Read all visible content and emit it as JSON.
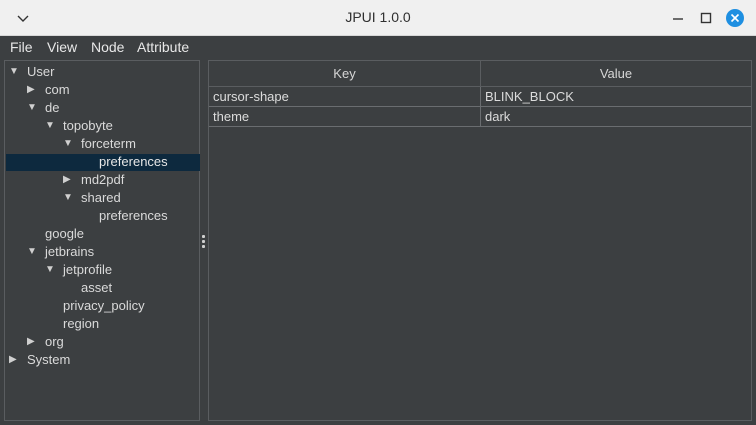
{
  "window": {
    "title": "JPUI 1.0.0"
  },
  "menubar": {
    "items": [
      "File",
      "View",
      "Node",
      "Attribute"
    ]
  },
  "tree": {
    "nodes": [
      {
        "label": "User",
        "arrow": "▼"
      },
      {
        "label": "com",
        "arrow": "▶"
      },
      {
        "label": "de",
        "arrow": "▼"
      },
      {
        "label": "topobyte",
        "arrow": "▼"
      },
      {
        "label": "forceterm",
        "arrow": "▼"
      },
      {
        "label": "preferences",
        "arrow": ""
      },
      {
        "label": "md2pdf",
        "arrow": "▶"
      },
      {
        "label": "shared",
        "arrow": "▼"
      },
      {
        "label": "preferences",
        "arrow": ""
      },
      {
        "label": "google",
        "arrow": ""
      },
      {
        "label": "jetbrains",
        "arrow": "▼"
      },
      {
        "label": "jetprofile",
        "arrow": "▼"
      },
      {
        "label": "asset",
        "arrow": ""
      },
      {
        "label": "privacy_policy",
        "arrow": ""
      },
      {
        "label": "region",
        "arrow": ""
      },
      {
        "label": "org",
        "arrow": "▶"
      },
      {
        "label": "System",
        "arrow": "▶"
      }
    ],
    "selected": "preferences"
  },
  "table": {
    "headers": {
      "key": "Key",
      "value": "Value"
    },
    "rows": [
      {
        "key": "cursor-shape",
        "value": "BLINK_BLOCK"
      },
      {
        "key": "theme",
        "value": "dark"
      }
    ]
  },
  "colors": {
    "background": "#3c3f41",
    "selection": "#0d293e",
    "close_button": "#1e8fe1"
  }
}
